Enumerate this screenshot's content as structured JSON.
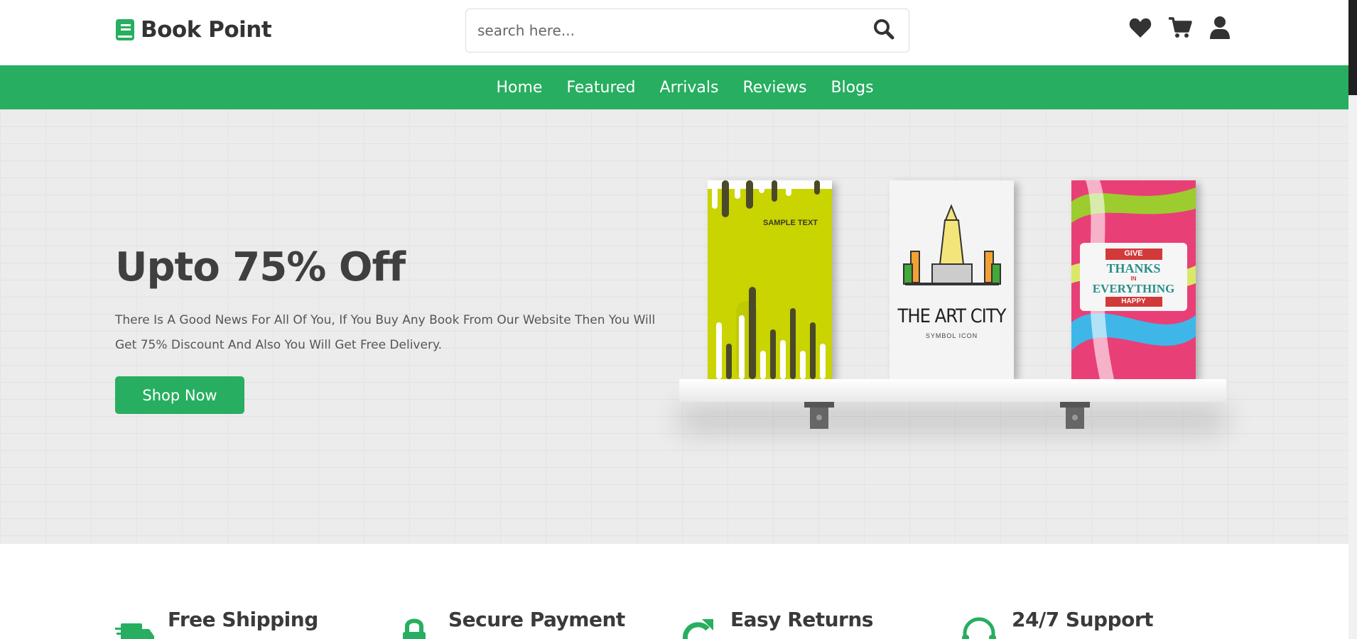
{
  "header": {
    "brand": "Book Point",
    "search": {
      "placeholder": "search here...",
      "value": ""
    },
    "icons": [
      "heart-icon",
      "cart-icon",
      "user-icon"
    ]
  },
  "nav": {
    "links": [
      "Home",
      "Featured",
      "Arrivals",
      "Reviews",
      "Blogs"
    ]
  },
  "hero": {
    "title": "Upto 75% Off",
    "text": "There Is A Good News For All Of You, If You Buy Any Book From Our Website Then You Will Get 75% Discount And Also You Will Get Free Delivery.",
    "button": "Shop Now",
    "books": [
      {
        "cover_text": "SAMPLE TEXT"
      },
      {
        "cover_title": "THE ART CITY",
        "cover_subtitle": "SYMBOL ICON"
      },
      {
        "cover_line1": "GIVE",
        "cover_line2": "THANKS",
        "cover_line3": "IN",
        "cover_line4": "EVERYTHING",
        "cover_line5": "HAPPY"
      }
    ]
  },
  "features": [
    {
      "title": "Free Shipping",
      "icon": "truck-icon"
    },
    {
      "title": "Secure Payment",
      "icon": "lock-icon"
    },
    {
      "title": "Easy Returns",
      "icon": "redo-icon"
    },
    {
      "title": "24/7 Support",
      "icon": "headset-icon"
    }
  ],
  "colors": {
    "accent": "#27ae60",
    "text_dark": "#333333",
    "hero_bg": "#ececec"
  }
}
